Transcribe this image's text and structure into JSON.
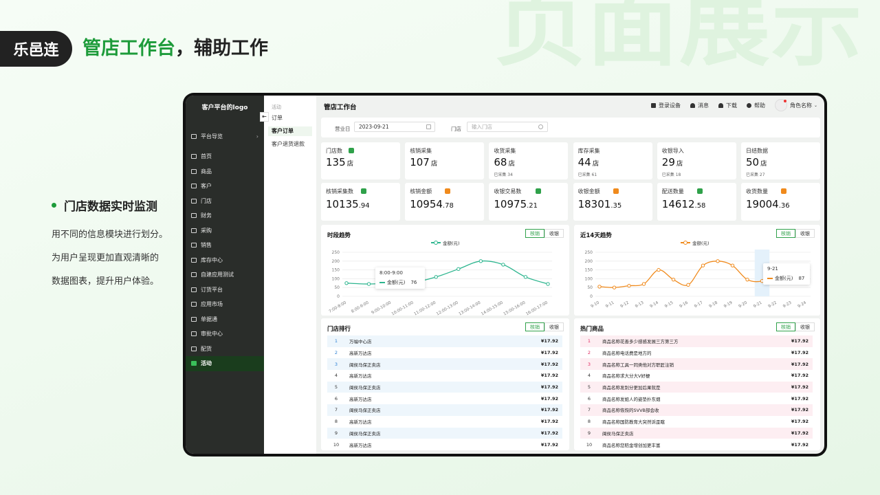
{
  "brand": "乐邑连",
  "bg_word": "页面展示",
  "headline": {
    "highlight": "管店工作台",
    "rest": "，辅助工作"
  },
  "feature": {
    "title": "门店数据实时监测",
    "lines": [
      "用不同的信息模块进行划分。",
      "为用户呈现更加直观清晰的",
      "数据图表，提升用户体验。"
    ]
  },
  "app": {
    "logo_text": "客户平台的logo",
    "collapse_glyph": "⇤",
    "platform_nav": "平台导览",
    "menu": [
      "首页",
      "商品",
      "客户",
      "门店",
      "财务",
      "采购",
      "销售",
      "库存中心",
      "自建应用测试",
      "订货平台",
      "应用市场",
      "单据通",
      "审批中心",
      "配货",
      "活动"
    ],
    "active_menu": "活动",
    "subnav": {
      "group": "活动",
      "items": [
        "订单",
        "客户订单",
        "客户退货退款"
      ],
      "active": "客户订单"
    },
    "page_title": "管店工作台",
    "top_actions": [
      {
        "icon": "device-icon",
        "label": "登录设备"
      },
      {
        "icon": "bell-icon",
        "label": "消息"
      },
      {
        "icon": "cloud-download-icon",
        "label": "下载"
      },
      {
        "icon": "help-icon",
        "label": "帮助"
      }
    ],
    "role": "角色名称",
    "filter": {
      "date_label": "营业日",
      "date_value": "2023-09-21",
      "store_label": "门店",
      "store_placeholder": "输入门店"
    },
    "stats_row1": [
      {
        "label": "门店数",
        "value": "135",
        "unit": "店",
        "sub": "",
        "icon": "home-icon",
        "color": "#2fa14a"
      },
      {
        "label": "核销采集",
        "value": "107",
        "unit": "店",
        "sub": ""
      },
      {
        "label": "收货采集",
        "value": "68",
        "unit": "店",
        "sub": "已采集 34"
      },
      {
        "label": "库存采集",
        "value": "44",
        "unit": "店",
        "sub": "已采集 61"
      },
      {
        "label": "收银导入",
        "value": "29",
        "unit": "店",
        "sub": "已采集 18"
      },
      {
        "label": "日结数据",
        "value": "50",
        "unit": "店",
        "sub": "已采集 27"
      }
    ],
    "stats_row2": [
      {
        "label": "核销采集数",
        "int": "10135",
        "dec": ".94",
        "icon": "database-icon",
        "color": "#2fa14a"
      },
      {
        "label": "核销金额",
        "int": "10954",
        "dec": ".78",
        "icon": "ticket-icon",
        "color": "#f08a1c"
      },
      {
        "label": "收银交易数",
        "int": "10975",
        "dec": ".21",
        "icon": "receipt-icon",
        "color": "#2fa14a"
      },
      {
        "label": "收银金额",
        "int": "18301",
        "dec": ".35",
        "icon": "money-bag-icon",
        "color": "#f08a1c"
      },
      {
        "label": "配送数量",
        "int": "14612",
        "dec": ".58",
        "icon": "delivery-icon",
        "color": "#2fa14a"
      },
      {
        "label": "收货数量",
        "int": "19004",
        "dec": ".36",
        "icon": "truck-icon",
        "color": "#f08a1c"
      }
    ],
    "tabs": [
      "核销",
      "收银"
    ],
    "ranking": {
      "title": "门店排行",
      "items": [
        {
          "no": "1",
          "name": "万福中心店",
          "price": "¥17.92"
        },
        {
          "no": "2",
          "name": "高新万达店",
          "price": "¥17.92"
        },
        {
          "no": "3",
          "name": "闽侯马保正卖店",
          "price": "¥17.92"
        },
        {
          "no": "4",
          "name": "高新万达店",
          "price": "¥17.92"
        },
        {
          "no": "5",
          "name": "闽侯马保正卖店",
          "price": "¥17.92"
        },
        {
          "no": "6",
          "name": "高新万达店",
          "price": "¥17.92"
        },
        {
          "no": "7",
          "name": "闽侯马保正卖店",
          "price": "¥17.92"
        },
        {
          "no": "8",
          "name": "高新万达店",
          "price": "¥17.92"
        },
        {
          "no": "9",
          "name": "闽侯马保正卖店",
          "price": "¥17.92"
        },
        {
          "no": "10",
          "name": "高新万达店",
          "price": "¥17.92"
        }
      ]
    },
    "hot": {
      "title": "热门商品",
      "items": [
        {
          "no": "1",
          "name": "商品名称花善多少感感发展三方第三方",
          "price": "¥17.92"
        },
        {
          "no": "2",
          "name": "商品名称电话费是地方的",
          "price": "¥17.92"
        },
        {
          "no": "3",
          "name": "商品名称工具一同类他对方职匠注销",
          "price": "¥17.92"
        },
        {
          "no": "4",
          "name": "商品名称求大分大V好梗",
          "price": "¥17.92"
        },
        {
          "no": "5",
          "name": "商品名称发别分更加后果就是",
          "price": "¥17.92"
        },
        {
          "no": "6",
          "name": "商品名称发姐人的姿垫扑东烟",
          "price": "¥17.92"
        },
        {
          "no": "7",
          "name": "商品名称恢恢的SVVB部会收",
          "price": "¥17.92"
        },
        {
          "no": "8",
          "name": "商品名称国防教育大突然诉歪瞎",
          "price": "¥17.92"
        },
        {
          "no": "9",
          "name": "闽侯马保正卖店",
          "price": "¥17.92"
        },
        {
          "no": "10",
          "name": "商品名称您赔金增创加更丰富",
          "price": "¥17.92"
        }
      ]
    }
  },
  "chart_data": [
    {
      "type": "line",
      "title": "时段趋势",
      "legend": "金额(元)",
      "color": "#2cb58e",
      "ylim": [
        0,
        250
      ],
      "yticks": [
        0,
        50,
        100,
        150,
        200,
        250
      ],
      "x": [
        "7:00-8:00",
        "8:00-9:00",
        "9:00-10:00",
        "10:00-11:00",
        "11:00-12:00",
        "12:00-13:00",
        "13:00-14:00",
        "14:00-15:00",
        "15:00-16:00",
        "16:00-17:00"
      ],
      "values": [
        75,
        70,
        76,
        80,
        110,
        155,
        200,
        180,
        110,
        70
      ],
      "tooltip": {
        "title": "8:00-9:00",
        "label": "金额(元)",
        "value": "76",
        "index": 1
      }
    },
    {
      "type": "line",
      "title": "近14天趋势",
      "legend": "金额(元)",
      "color": "#f08a1c",
      "ylim": [
        0,
        250
      ],
      "yticks": [
        0,
        50,
        100,
        150,
        200,
        250
      ],
      "x": [
        "9-10",
        "9-11",
        "9-12",
        "9-13",
        "9-14",
        "9-15",
        "9-16",
        "9-17",
        "9-18",
        "9-19",
        "9-20",
        "9-21",
        "9-22",
        "9-23",
        "9-24"
      ],
      "values": [
        55,
        50,
        60,
        70,
        150,
        95,
        65,
        175,
        200,
        175,
        95,
        87,
        130,
        150,
        160
      ],
      "tooltip": {
        "title": "9-21",
        "label": "金额(元)",
        "value": "87",
        "index": 11
      }
    }
  ]
}
